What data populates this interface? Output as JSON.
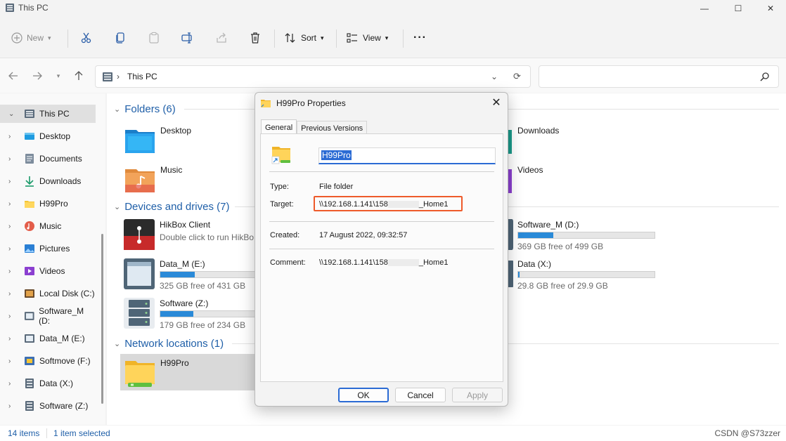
{
  "window": {
    "title": "This PC",
    "minimize_label": "—",
    "maximize_label": "☐",
    "close_label": "✕"
  },
  "commands": {
    "new_label": "New",
    "sort_label": "Sort",
    "view_label": "View",
    "more_label": "···"
  },
  "address": {
    "path": "This PC",
    "chevron": "›",
    "search_placeholder": ""
  },
  "sidebar": {
    "items": [
      {
        "label": "This PC"
      },
      {
        "label": "Desktop"
      },
      {
        "label": "Documents"
      },
      {
        "label": "Downloads"
      },
      {
        "label": "H99Pro"
      },
      {
        "label": "Music"
      },
      {
        "label": "Pictures"
      },
      {
        "label": "Videos"
      },
      {
        "label": "Local Disk (C:)"
      },
      {
        "label": "Software_M (D:"
      },
      {
        "label": "Data_M (E:)"
      },
      {
        "label": "Softmove (F:)"
      },
      {
        "label": "Data (X:)"
      },
      {
        "label": "Software (Z:)"
      }
    ]
  },
  "content": {
    "folders_header": "Folders (6)",
    "devices_header": "Devices and drives (7)",
    "network_header": "Network locations (1)",
    "folders": [
      {
        "name": "Desktop"
      },
      {
        "name": "Music"
      },
      {
        "name": "Downloads"
      },
      {
        "name": "Videos"
      }
    ],
    "devices": {
      "hikbox_name": "HikBox Client",
      "hikbox_sub": "Double click to run HikBo",
      "data_m_name": "Data_M (E:)",
      "data_m_free": "325 GB free of 431 GB",
      "data_m_used_fraction": 0.25,
      "software_z_name": "Software (Z:)",
      "software_z_free": "179 GB free of 234 GB",
      "software_z_used_fraction": 0.24,
      "software_m_name": "Software_M (D:)",
      "software_m_free": "369 GB free of 499 GB",
      "software_m_used_fraction": 0.26,
      "data_x_name": "Data (X:)",
      "data_x_free": "29.8 GB free of 29.9 GB",
      "data_x_used_fraction": 0.01
    },
    "network": {
      "name": "H99Pro"
    }
  },
  "status": {
    "items_count": "14 items",
    "selection": "1 item selected",
    "watermark": "CSDN @S73zzer"
  },
  "dialog": {
    "title": "H99Pro Properties",
    "close_label": "✕",
    "tabs": [
      {
        "label": "General"
      },
      {
        "label": "Previous Versions"
      }
    ],
    "name_value": "H99Pro",
    "type_label": "Type:",
    "type_value": "File folder",
    "target_label": "Target:",
    "target_prefix": "\\\\192.168.1.141\\158",
    "target_suffix": "_Home1",
    "created_label": "Created:",
    "created_value": "17 August 2022, 09:32:57",
    "comment_label": "Comment:",
    "comment_prefix": "\\\\192.168.1.141\\158",
    "comment_suffix": "_Home1",
    "ok_label": "OK",
    "cancel_label": "Cancel",
    "apply_label": "Apply"
  },
  "colors": {
    "accent": "#2b6bd4",
    "highlight_box": "#ee5a2a",
    "drive_fill": "#2a8ad8",
    "group_header": "#1f5fa8"
  }
}
